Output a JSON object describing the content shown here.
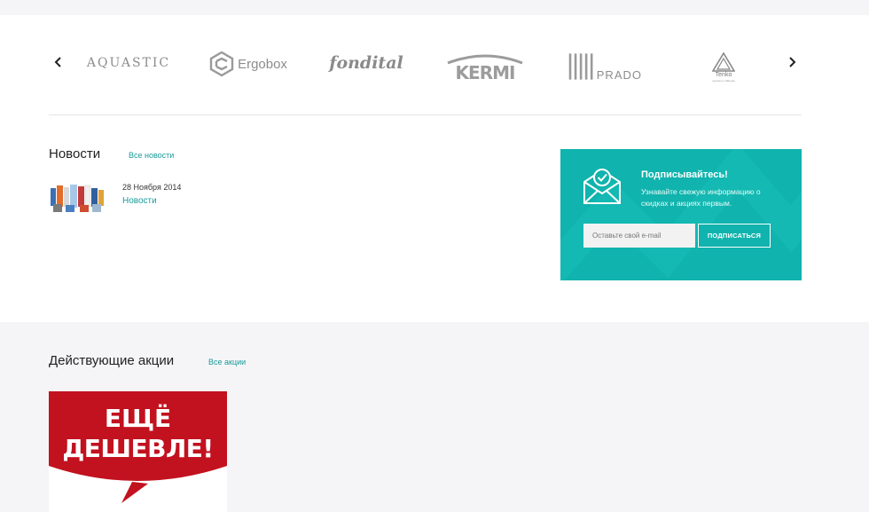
{
  "brands": {
    "prev_label": "‹",
    "next_label": "›",
    "items": [
      {
        "name": "AQUASTIC"
      },
      {
        "name": "Ergobox"
      },
      {
        "name": "fondital"
      },
      {
        "name": "KERMI"
      },
      {
        "name": "PRADO"
      },
      {
        "name": "Tenko",
        "tagline": "сделано в Швеции"
      }
    ]
  },
  "news": {
    "title": "Новости",
    "all_link": "Все новости",
    "items": [
      {
        "date": "28 Ноября 2014",
        "category": "Новости"
      }
    ]
  },
  "subscribe": {
    "title": "Подписывайтесь!",
    "text": "Узнавайте свежую информацию о скидках и акциях первым.",
    "placeholder": "Оставьте свой e-mail",
    "button": "ПОДПИСАТЬСЯ"
  },
  "promos": {
    "title": "Действующие акции",
    "all_link": "Все акции",
    "items": [
      {
        "line1": "ЕЩЁ",
        "line2": "ДЕШЕВЛЕ!"
      }
    ]
  },
  "colors": {
    "accent": "#10b3ad",
    "link": "#1a9b9b",
    "promo_red": "#c2121f"
  }
}
